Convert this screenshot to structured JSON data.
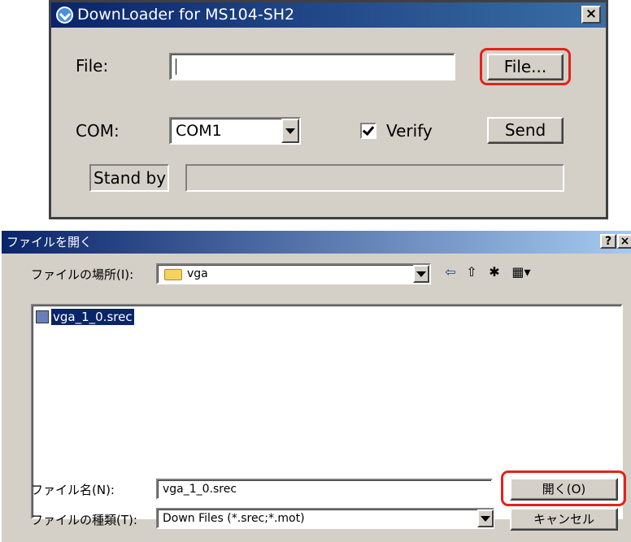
{
  "downloader": {
    "title": "DownLoader for MS104-SH2",
    "close": "×",
    "file_label": "File:",
    "file_value": "",
    "file_button": "File...",
    "com_label": "COM:",
    "com_value": "COM1",
    "verify_label": "Verify",
    "verify_checked": true,
    "send_button": "Send",
    "status_text": "Stand by",
    "progress": 0
  },
  "open_dialog": {
    "title": "ファイルを開く",
    "help": "?",
    "close": "×",
    "look_in_label": "ファイルの場所(I):",
    "look_in_value": "vga",
    "icons": {
      "back": "⇦",
      "up": "⇧",
      "new_folder": "✱",
      "view": "▦▾"
    },
    "files": [
      {
        "name": "vga_1_0.srec",
        "selected": true
      }
    ],
    "filename_label": "ファイル名(N):",
    "filename_value": "vga_1_0.srec",
    "filetype_label": "ファイルの種類(T):",
    "filetype_value": "Down Files (*.srec;*.mot)",
    "open_button": "開く(O)",
    "cancel_button": "キャンセル"
  }
}
